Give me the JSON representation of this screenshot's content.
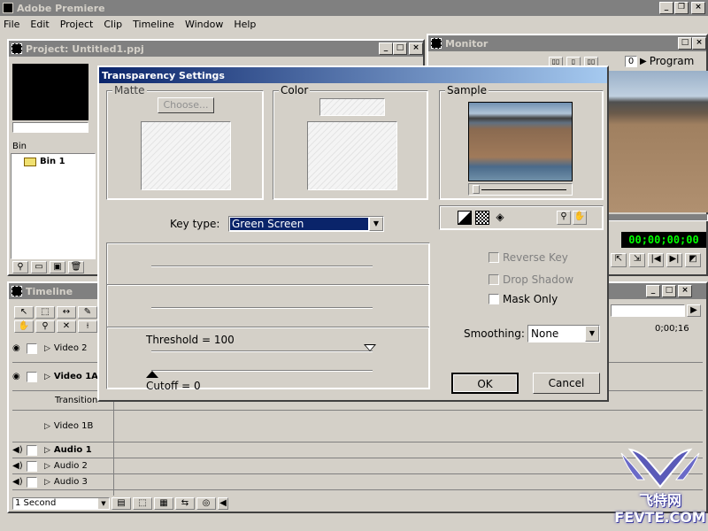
{
  "app": {
    "title": "Adobe Premiere"
  },
  "menu": [
    "File",
    "Edit",
    "Project",
    "Clip",
    "Timeline",
    "Window",
    "Help"
  ],
  "project": {
    "title": "Project: Untitled1.ppj",
    "bin_header": "Bin",
    "bin_item": "Bin 1"
  },
  "monitor": {
    "title": "Monitor",
    "program_label": "Program",
    "program_num": "0",
    "timecode": "00;00;00;00"
  },
  "timeline": {
    "title": "Timeline",
    "ruler_time": "0;00;16",
    "tracks": [
      "Video 2",
      "Video 1A",
      "Transition",
      "Video 1B",
      "Audio 1",
      "Audio 2",
      "Audio 3"
    ],
    "zoom": "1 Second"
  },
  "dialog": {
    "title": "Transparency Settings",
    "matte": {
      "label": "Matte",
      "choose": "Choose..."
    },
    "color": {
      "label": "Color"
    },
    "sample": {
      "label": "Sample"
    },
    "key_type": {
      "label": "Key type:",
      "value": "Green Screen"
    },
    "threshold": "Threshold = 100",
    "cutoff": "Cutoff = 0",
    "reverse_key": "Reverse Key",
    "drop_shadow": "Drop Shadow",
    "mask_only": "Mask Only",
    "smoothing": {
      "label": "Smoothing:",
      "value": "None"
    },
    "ok": "OK",
    "cancel": "Cancel"
  },
  "watermark": {
    "text1": "飞特网",
    "text2": "FEVTE.COM"
  }
}
